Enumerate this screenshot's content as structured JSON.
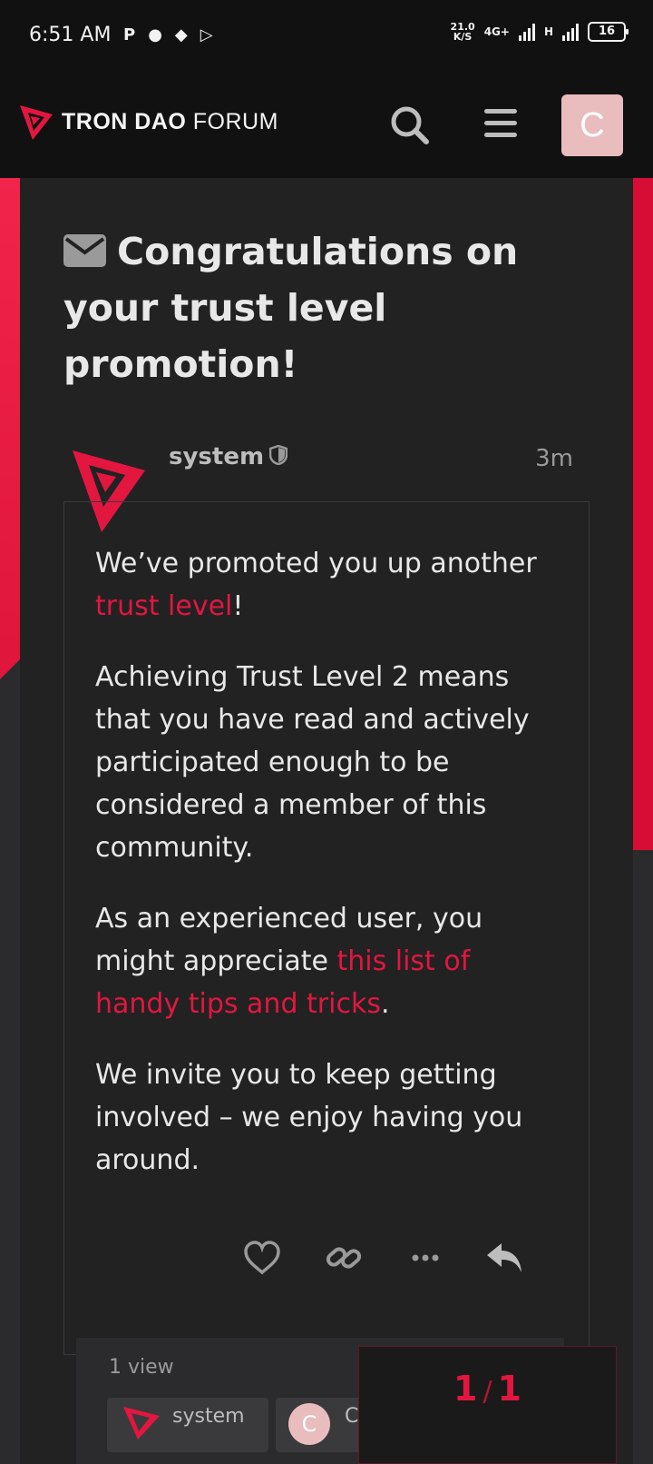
{
  "status_bar": {
    "time": "6:51 AM",
    "speed_value": "21.0",
    "speed_unit": "K/S",
    "network": "4G+",
    "network2": "H",
    "battery": "16"
  },
  "header": {
    "brand_bold": "TRON DAO",
    "brand_light": "FORUM",
    "avatar_letter": "C"
  },
  "topic": {
    "title": "Congratulations on your trust level promotion!"
  },
  "post": {
    "username": "system",
    "time_ago": "3m",
    "p1_before": "We’ve promoted you up another ",
    "p1_link": "trust level",
    "p1_after": "!",
    "p2": "Achieving Trust Level 2 means that you have read and actively participated enough to be considered a member of this community.",
    "p3_before": "As an experienced user, you might appreciate ",
    "p3_link": "this list of handy tips and tricks",
    "p3_after": ".",
    "p4": "We invite you to keep getting involved – we enjoy having you around."
  },
  "footer": {
    "views": "1 view",
    "participant1": "system",
    "participant2_letter": "C",
    "participant2": "C"
  },
  "progress": {
    "current": "1",
    "separator": "/",
    "total": "1"
  },
  "colors": {
    "accent": "#e3163f",
    "background": "#222223",
    "avatar": "#e9bdbd"
  }
}
